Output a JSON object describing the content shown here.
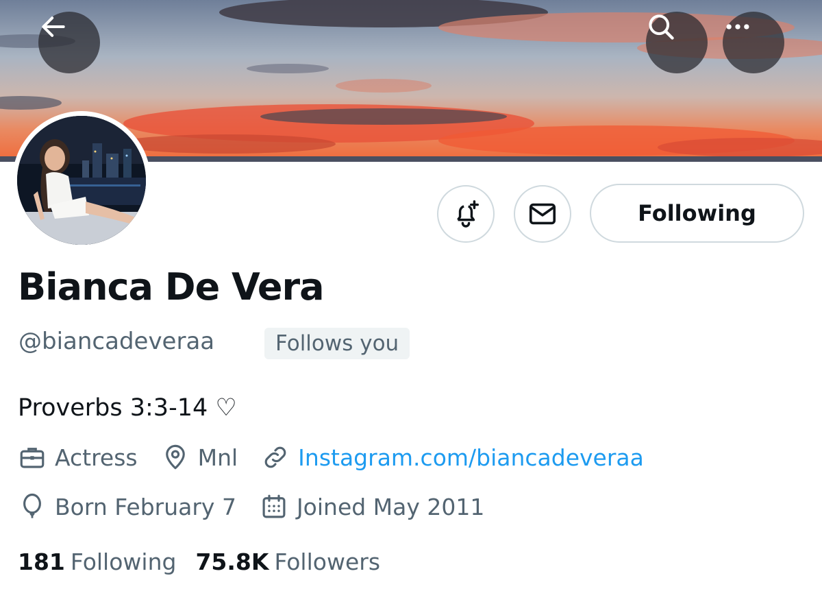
{
  "header": {
    "back_icon": "arrow-left-icon",
    "search_icon": "search-icon",
    "more_icon": "more-horizontal-icon"
  },
  "profile": {
    "display_name": "Bianca De Vera",
    "handle": "@biancadeveraa",
    "follows_you_badge": "Follows you",
    "bio": "Proverbs 3:3-14 ♡",
    "profession": "Actress",
    "location": "Mnl",
    "website": "Instagram.com/biancadeveraa",
    "birthday": "Born February 7",
    "joined": "Joined May 2011"
  },
  "actions": {
    "notify_icon": "bell-plus-icon",
    "message_icon": "envelope-icon",
    "following_label": "Following"
  },
  "stats": {
    "following_count": "181",
    "following_label": "Following",
    "followers_count": "75.8K",
    "followers_label": "Followers"
  },
  "colors": {
    "link": "#1d9bf0",
    "secondary_text": "#536471",
    "primary_text": "#0f1419",
    "border": "#cfd9de",
    "badge_bg": "#eff3f4"
  }
}
